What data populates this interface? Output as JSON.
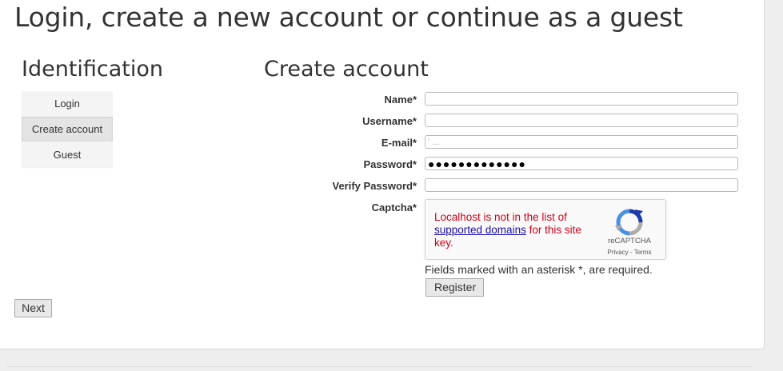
{
  "page": {
    "title": "Login, create a new account or continue as a guest"
  },
  "identification": {
    "title": "Identification",
    "items": [
      {
        "label": "Login",
        "active": false
      },
      {
        "label": "Create account",
        "active": true
      },
      {
        "label": "Guest",
        "active": false
      }
    ]
  },
  "create_account": {
    "title": "Create account",
    "fields": {
      "name": {
        "label": "Name*",
        "value": ""
      },
      "username": {
        "label": "Username*",
        "value": ""
      },
      "email": {
        "label": "E-mail*",
        "value": "' ..."
      },
      "password": {
        "label": "Password*",
        "value": "●●●●●●●●●●●●●"
      },
      "verify_password": {
        "label": "Verify Password*",
        "value": ""
      },
      "captcha": {
        "label": "Captcha*"
      }
    },
    "captcha": {
      "error_before": "Localhost is not in the list of ",
      "error_link": "supported domains",
      "error_after": " for this site key.",
      "brand": "reCAPTCHA",
      "links": "Privacy - Terms",
      "logo_colors": {
        "blue": "#1c3aa9",
        "light_blue": "#4a90e2",
        "gray": "#ababab"
      }
    },
    "required_note": "Fields marked with an asterisk *, are required.",
    "register_label": "Register"
  },
  "next_label": "Next",
  "colors": {
    "error": "#d0021b",
    "link": "#1a0dab"
  }
}
